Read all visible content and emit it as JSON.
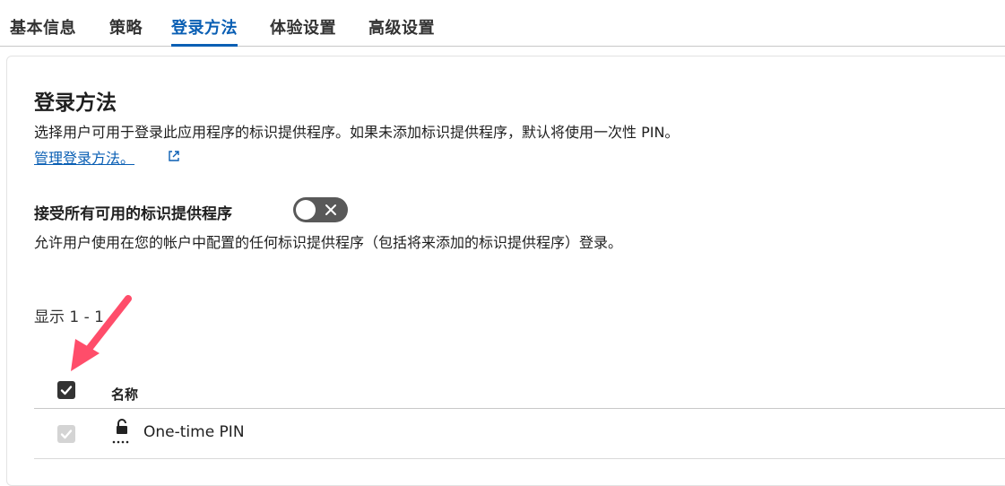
{
  "tabs": [
    {
      "label": "基本信息"
    },
    {
      "label": "策略"
    },
    {
      "label": "登录方法",
      "active": true
    },
    {
      "label": "体验设置"
    },
    {
      "label": "高级设置"
    }
  ],
  "section": {
    "title": "登录方法",
    "description": "选择用户可用于登录此应用程序的标识提供程序。如果未添加标识提供程序，默认将使用一次性 PIN。",
    "manage_link": "管理登录方法。"
  },
  "accept_all": {
    "label": "接受所有可用的标识提供程序",
    "enabled": false,
    "description": "允许用户使用在您的帐户中配置的任何标识提供程序（包括将来添加的标识提供程序）登录。"
  },
  "table": {
    "count_text": "显示 1 - 1",
    "header_all_checked": true,
    "column_name": "名称",
    "rows": [
      {
        "name": "One-time PIN",
        "icon": "unlock-pin-icon",
        "checked": true,
        "disabled": true
      }
    ]
  },
  "colors": {
    "accent": "#0a5fb4",
    "annotation_arrow": "#ff4d6a",
    "toggle_off": "#595959"
  }
}
